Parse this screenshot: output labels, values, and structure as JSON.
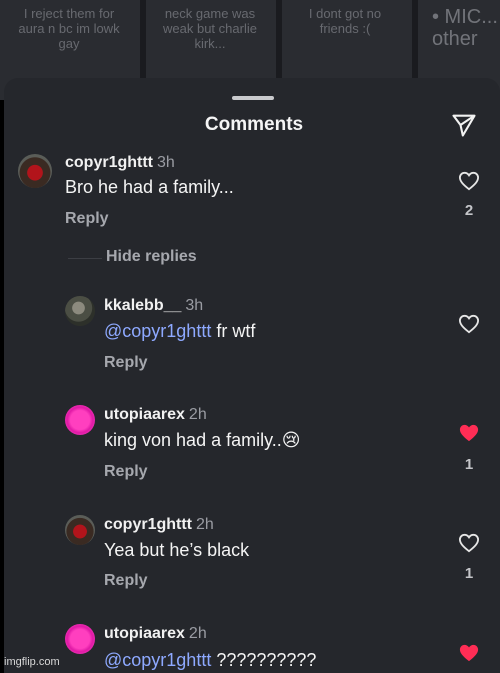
{
  "background": {
    "tiles": [
      {
        "text": "I reject them for aura n bc im lowk gay"
      },
      {
        "text": "neck game was weak but charlie kirk..."
      },
      {
        "text": "I dont got no friends :("
      },
      {
        "text": "• MIC... other"
      }
    ]
  },
  "header": {
    "title": "Comments",
    "send_icon": "paper-plane-icon"
  },
  "comments": [
    {
      "username": "copyr1ghttt",
      "time": "3h",
      "text": "Bro he had a family...",
      "reply": "Reply",
      "likes": "2",
      "liked": false
    },
    {
      "username": "kkalebb__",
      "time": "3h",
      "mention": "@copyr1ghttt",
      "text": " fr wtf",
      "reply": "Reply",
      "likes": "",
      "liked": false
    },
    {
      "username": "utopiaarex",
      "time": "2h",
      "text": "king von had a family..😢",
      "reply": "Reply",
      "likes": "1",
      "liked": true
    },
    {
      "username": "copyr1ghttt",
      "time": "2h",
      "text": "Yea but he’s black",
      "reply": "Reply",
      "likes": "1",
      "liked": false
    },
    {
      "username": "utopiaarex",
      "time": "2h",
      "mention": "@copyr1ghttt",
      "text": " ??????????",
      "reply": "",
      "likes": "",
      "liked": true
    }
  ],
  "thread": {
    "hide_replies": "Hide replies"
  },
  "watermark": "imgflip.com",
  "colors": {
    "sheet": "#25272c",
    "liked_heart": "#ff2d55",
    "mention": "#8ea9ff"
  }
}
